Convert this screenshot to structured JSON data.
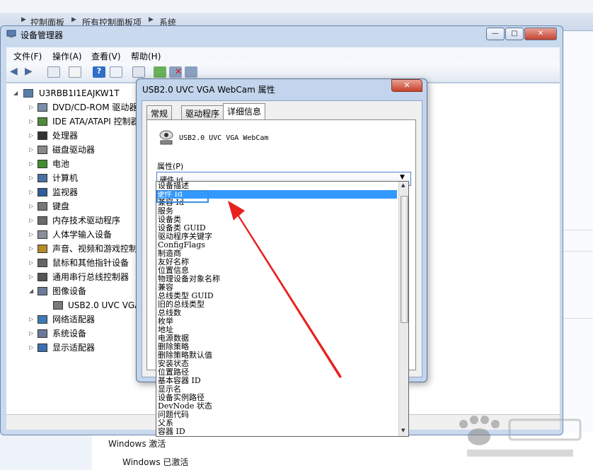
{
  "address_bar": {
    "crumbs": [
      "控制面板",
      "所有控制面板项",
      "系统"
    ]
  },
  "dm_window": {
    "title": "设备管理器",
    "caption_buttons": [
      "—",
      "□",
      "✕"
    ],
    "menu": [
      "文件(F)",
      "操作(A)",
      "查看(V)",
      "帮助(H)"
    ],
    "tree": {
      "root": "U3RBB1I1EAJKW1T",
      "items": [
        "DVD/CD-ROM 驱动器",
        "IDE ATA/ATAPI 控制器",
        "处理器",
        "磁盘驱动器",
        "电池",
        "计算机",
        "监视器",
        "键盘",
        "内存技术驱动程序",
        "人体学输入设备",
        "声音、视频和游戏控制器",
        "鼠标和其他指针设备",
        "通用串行总线控制器",
        "图像设备",
        "USB2.0 UVC VGA WebCam",
        "网络适配器",
        "系统设备",
        "显示适配器"
      ]
    }
  },
  "props_dialog": {
    "title": "USB2.0 UVC VGA WebCam 属性",
    "close_glyph": "✕",
    "tabs": [
      "常规",
      "驱动程序",
      "详细信息"
    ],
    "active_tab": "详细信息",
    "device_name": "USB2.0 UVC VGA WebCam",
    "property_label": "属性(P)",
    "selected_property": "硬件 Id"
  },
  "dropdown": {
    "items": [
      "设备描述",
      "硬件 Id",
      "兼容 Id",
      "服务",
      "设备类",
      "设备类 GUID",
      "驱动程序关键字",
      "ConfigFlags",
      "制造商",
      "友好名称",
      "位置信息",
      "物理设备对象名称",
      "兼容",
      "总线类型 GUID",
      "旧的总线类型",
      "总线数",
      "枚举",
      "地址",
      "电源数据",
      "删除策略",
      "删除策略默认值",
      "安装状态",
      "位置路径",
      "基本容器 ID",
      "显示名",
      "设备实例路径",
      "DevNode 状态",
      "问题代码",
      "父系",
      "容器 ID"
    ],
    "selected_index": 1
  },
  "activation": {
    "line1": "Windows 激活",
    "line2": "Windows 已激活"
  },
  "colors": {
    "selection": "#3399ff",
    "arrow": "#e8211d"
  }
}
